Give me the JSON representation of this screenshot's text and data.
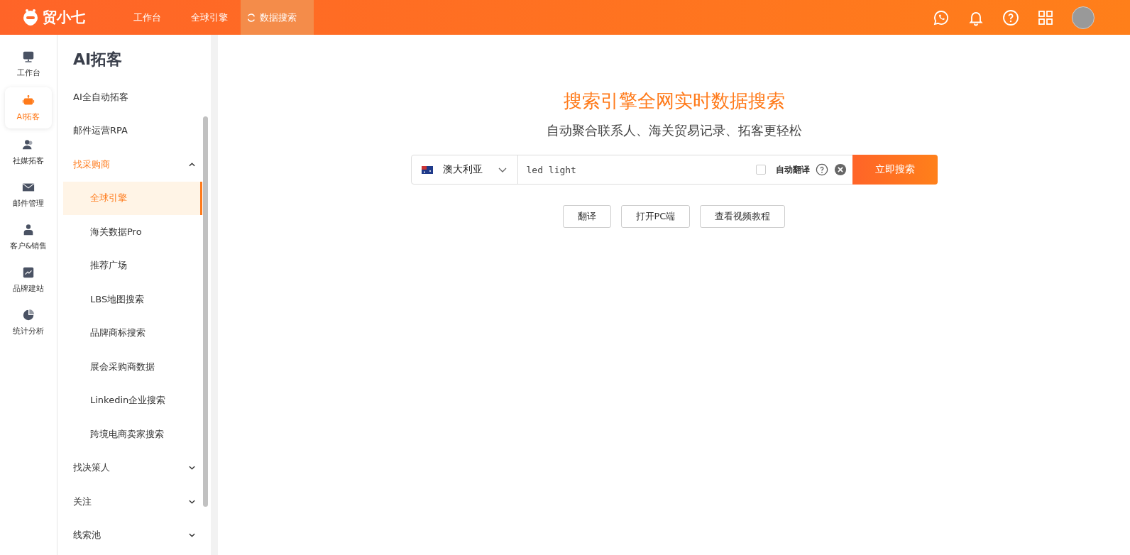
{
  "header": {
    "brand": "贸小七",
    "tabs": [
      {
        "label": "工作台",
        "selected": false
      },
      {
        "label": "全球引擎",
        "selected": false
      },
      {
        "label": "数据搜索",
        "selected": true
      }
    ]
  },
  "rail": [
    {
      "label": "工作台",
      "selected": false
    },
    {
      "label": "AI拓客",
      "selected": true
    },
    {
      "label": "社媒拓客",
      "selected": false
    },
    {
      "label": "邮件管理",
      "selected": false
    },
    {
      "label": "客户&销售",
      "selected": false
    },
    {
      "label": "品牌建站",
      "selected": false
    },
    {
      "label": "统计分析",
      "selected": false
    }
  ],
  "submenu": {
    "title": "AI拓客",
    "items": [
      {
        "label": "AI全自动拓客",
        "selected": false
      },
      {
        "label": "邮件运营RPA",
        "selected": false
      },
      {
        "label": "找采购商",
        "expanded": true,
        "children": [
          {
            "label": "全球引擎",
            "selected": true
          },
          {
            "label": "海关数据Pro",
            "selected": false
          },
          {
            "label": "推荐广场",
            "selected": false
          },
          {
            "label": "LBS地图搜索",
            "selected": false
          },
          {
            "label": "品牌商标搜索",
            "selected": false
          },
          {
            "label": "展会采购商数据",
            "selected": false
          },
          {
            "label": "Linkedin企业搜索",
            "selected": false
          },
          {
            "label": "跨境电商卖家搜索",
            "selected": false
          }
        ]
      },
      {
        "label": "找决策人",
        "expanded": false
      },
      {
        "label": "关注",
        "expanded": false
      },
      {
        "label": "线索池",
        "expanded": false
      }
    ]
  },
  "main": {
    "title": "搜索引擎全网实时数据搜索",
    "subtitle": "自动聚合联系人、海关贸易记录、拓客更轻松",
    "search": {
      "country": "澳大利亚",
      "value": "led light",
      "auto_translate": {
        "label": "自动翻译",
        "checked": false
      },
      "button": "立即搜索"
    },
    "buttons": [
      "翻译",
      "打开PC端",
      "查看视频教程"
    ]
  }
}
